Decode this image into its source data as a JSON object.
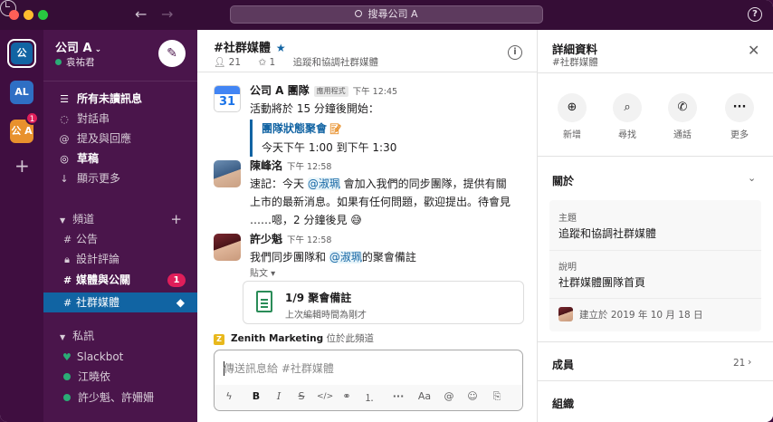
{
  "topbar": {
    "search_placeholder": "搜尋公司 A",
    "help": "?"
  },
  "rail": {
    "workspaces": [
      "公",
      "AL",
      "公 A"
    ],
    "badge": "1"
  },
  "sidebar": {
    "workspace_name": "公司 A",
    "user_name": "袁祐君",
    "top_items": [
      {
        "label": "所有未讀訊息",
        "icon": "unread-icon"
      },
      {
        "label": "對話串",
        "icon": "threads-icon"
      },
      {
        "label": "提及與回應",
        "icon": "mention-icon"
      },
      {
        "label": "草稿",
        "icon": "draft-icon"
      },
      {
        "label": "顯示更多",
        "icon": "chevron-down-icon"
      }
    ],
    "channels_title": "頻道",
    "channels": [
      {
        "name": "公告"
      },
      {
        "name": "設計評論"
      },
      {
        "name": "媒體與公關",
        "badge": "1"
      },
      {
        "name": "社群媒體"
      }
    ],
    "dm_title": "私訊",
    "dms": [
      "Slackbot",
      "江曉依",
      "許少魁、許姍姍"
    ]
  },
  "channel": {
    "title": "#社群媒體",
    "members": "21",
    "pins": "1",
    "topic": "追蹤和協調社群媒體"
  },
  "messages": [
    {
      "sender": "公司 A 團隊",
      "tag": "應用程式",
      "time": "下午 12:45",
      "text": "活動將於 15 分鐘後開始：",
      "event_title": "團隊狀態聚會",
      "event_time": "今天下午 1:00 到下午 1:30",
      "calendar_day": "31"
    },
    {
      "sender": "陳峰洺",
      "time": "下午 12:58",
      "line1_pre": "速記：今天 ",
      "mention": "@淑珮",
      "line1_post": " 會加入我們的同步團隊，提供有關",
      "line2": "上市的最新消息。如果有任何問題，歡迎提出。待會見",
      "line3": "……嗯，2 分鐘後見 😅"
    },
    {
      "sender": "許少魁",
      "time": "下午 12:58",
      "pre": "我們同步團隊和 ",
      "mention": "@淑珮",
      "post": "的聚會備註",
      "post_label": "貼文",
      "file_title": "1/9 聚會備註",
      "file_sub": "上次編輯時間為剛才"
    }
  ],
  "zenith": {
    "icon_letter": "Z",
    "name": "Zenith Marketing",
    "suffix": "位於此頻道"
  },
  "composer": {
    "placeholder": "傳送訊息給 #社群媒體"
  },
  "details": {
    "title": "詳細資料",
    "subtitle": "#社群媒體",
    "actions": [
      {
        "label": "新增",
        "icon": "add-person-icon"
      },
      {
        "label": "尋找",
        "icon": "find-icon"
      },
      {
        "label": "通話",
        "icon": "phone-icon"
      },
      {
        "label": "更多",
        "icon": "more-icon"
      }
    ],
    "about_title": "關於",
    "topic_label": "主題",
    "topic_value": "追蹤和協調社群媒體",
    "desc_label": "說明",
    "desc_value": "社群媒體團隊首頁",
    "created": "建立於 2019 年 10 月 18 日",
    "members_title": "成員",
    "members_count": "21",
    "org_title": "組織"
  }
}
